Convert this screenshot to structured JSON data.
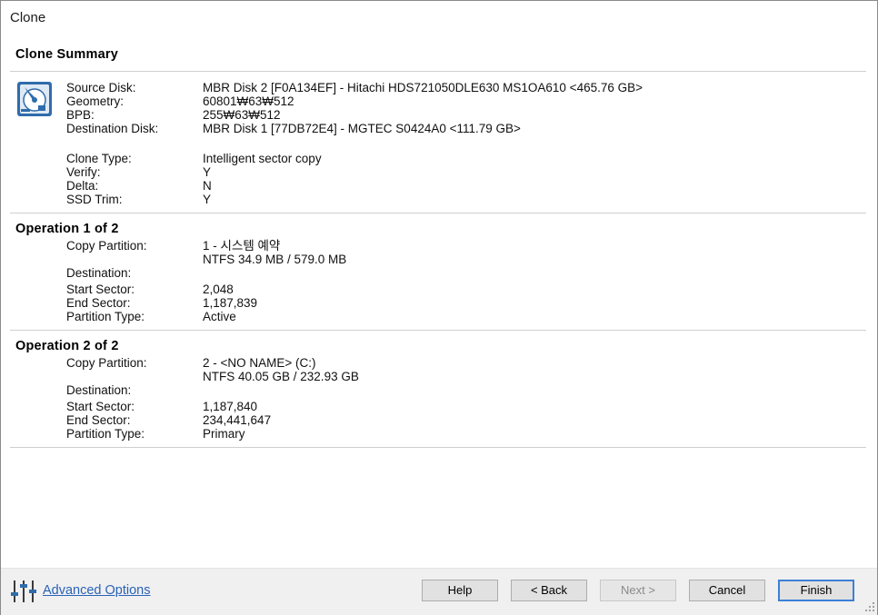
{
  "window": {
    "title": "Clone"
  },
  "summary": {
    "heading": "Clone Summary",
    "rows": [
      {
        "label": "Source Disk:",
        "value": "MBR Disk 2 [F0A134EF] - Hitachi HDS721050DLE630 MS1OA610  <465.76 GB>"
      },
      {
        "label": "Geometry:",
        "value": "60801₩63₩512"
      },
      {
        "label": "BPB:",
        "value": "255₩63₩512"
      },
      {
        "label": "Destination Disk:",
        "value": "MBR Disk 1 [77DB72E4] - MGTEC S0424A0  <111.79 GB>"
      }
    ],
    "options": [
      {
        "label": "Clone Type:",
        "value": "Intelligent sector copy"
      },
      {
        "label": "Verify:",
        "value": "Y"
      },
      {
        "label": "Delta:",
        "value": "N"
      },
      {
        "label": "SSD Trim:",
        "value": "Y"
      }
    ]
  },
  "operations": [
    {
      "heading": "Operation 1 of 2",
      "copy_partition_label": "Copy Partition:",
      "copy_partition_value": "1 - 시스템 예약",
      "copy_partition_detail": "NTFS 34.9 MB / 579.0 MB",
      "destination_label": "Destination:",
      "start_sector_label": "Start Sector:",
      "start_sector_value": "2,048",
      "end_sector_label": "End Sector:",
      "end_sector_value": "1,187,839",
      "partition_type_label": "Partition Type:",
      "partition_type_value": "Active"
    },
    {
      "heading": "Operation 2 of 2",
      "copy_partition_label": "Copy Partition:",
      "copy_partition_value": "2 - <NO NAME> (C:)",
      "copy_partition_detail": "NTFS 40.05 GB / 232.93 GB",
      "destination_label": "Destination:",
      "start_sector_label": "Start Sector:",
      "start_sector_value": "1,187,840",
      "end_sector_label": "End Sector:",
      "end_sector_value": "234,441,647",
      "partition_type_label": "Partition Type:",
      "partition_type_value": "Primary"
    }
  ],
  "footer": {
    "advanced_options_icon": "sliders-icon",
    "advanced_options": "Advanced Options",
    "buttons": {
      "help": "Help",
      "back": "< Back",
      "next": "Next >",
      "cancel": "Cancel",
      "finish": "Finish"
    }
  },
  "colors": {
    "link": "#2a62b8",
    "button_face": "#e1e1e1",
    "default_button_border": "#3c7fd6",
    "footer_bg": "#f0f0f0",
    "disk_icon_blue": "#2f6cab"
  }
}
